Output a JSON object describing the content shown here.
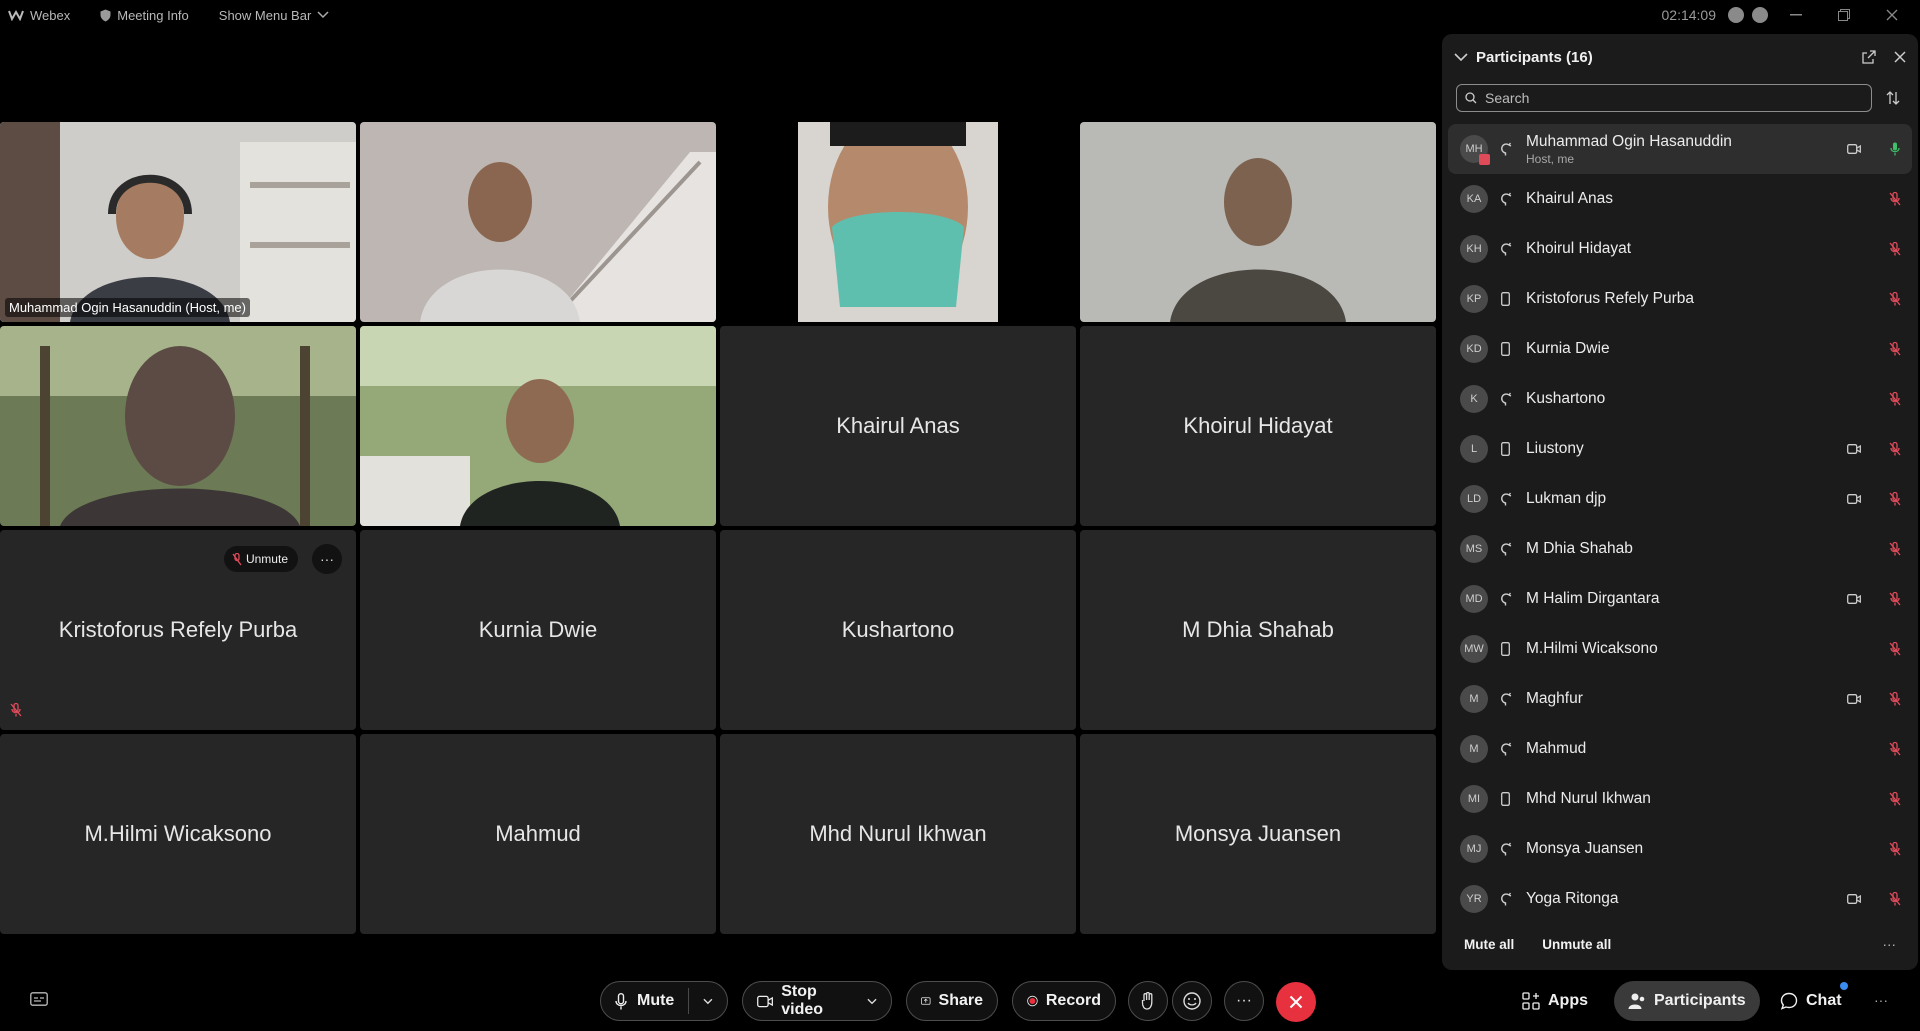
{
  "titlebar": {
    "app_name": "Webex",
    "meeting_info": "Meeting Info",
    "show_menu_bar": "Show Menu Bar",
    "time": "02:14:09"
  },
  "grid": {
    "self_label": "Muhammad Ogin Hasanuddin (Host, me)",
    "tiles": [
      "Khairul Anas",
      "Khoirul Hidayat",
      "Kristoforus Refely Purba",
      "Kurnia Dwie",
      "Kushartono",
      "M Dhia Shahab",
      "M.Hilmi Wicaksono",
      "Mahmud",
      "Mhd Nurul Ikhwan",
      "Monsya Juansen"
    ],
    "unmute_label": "Unmute",
    "more_label": "···"
  },
  "panel": {
    "title": "Participants (16)",
    "search_placeholder": "Search",
    "me": {
      "initials": "MH",
      "name": "Muhammad Ogin Hasanuddin",
      "sub": "Host, me"
    },
    "participants": [
      {
        "initials": "KA",
        "name": "Khairul Anas",
        "device": "desktop",
        "camera": false
      },
      {
        "initials": "KH",
        "name": "Khoirul Hidayat",
        "device": "desktop",
        "camera": false
      },
      {
        "initials": "KP",
        "name": "Kristoforus Refely Purba",
        "device": "mobile",
        "camera": false
      },
      {
        "initials": "KD",
        "name": "Kurnia Dwie",
        "device": "mobile",
        "camera": false
      },
      {
        "initials": "K",
        "name": "Kushartono",
        "device": "desktop",
        "camera": false
      },
      {
        "initials": "L",
        "name": "Liustony",
        "device": "mobile",
        "camera": true
      },
      {
        "initials": "LD",
        "name": "Lukman djp",
        "device": "desktop",
        "camera": true
      },
      {
        "initials": "MS",
        "name": "M Dhia Shahab",
        "device": "desktop",
        "camera": false
      },
      {
        "initials": "MD",
        "name": "M Halim Dirgantara",
        "device": "desktop",
        "camera": true
      },
      {
        "initials": "MW",
        "name": "M.Hilmi Wicaksono",
        "device": "mobile",
        "camera": false
      },
      {
        "initials": "M",
        "name": "Maghfur",
        "device": "desktop",
        "camera": true
      },
      {
        "initials": "M",
        "name": "Mahmud",
        "device": "desktop",
        "camera": false
      },
      {
        "initials": "MI",
        "name": "Mhd Nurul Ikhwan",
        "device": "mobile",
        "camera": false
      },
      {
        "initials": "MJ",
        "name": "Monsya Juansen",
        "device": "desktop",
        "camera": false
      },
      {
        "initials": "YR",
        "name": "Yoga Ritonga",
        "device": "desktop",
        "camera": true
      }
    ],
    "mute_all": "Mute all",
    "unmute_all": "Unmute all",
    "more": "···"
  },
  "bottombar": {
    "mute": "Mute",
    "stop_video": "Stop video",
    "share": "Share",
    "record": "Record",
    "more": "···",
    "apps": "Apps",
    "participants": "Participants",
    "chat": "Chat"
  },
  "colors": {
    "accent": "#5aa7f0",
    "end_call": "#e8313f",
    "mic_off": "#e04b5a",
    "mic_on": "#3fbf6a",
    "record": "#e8313f"
  }
}
